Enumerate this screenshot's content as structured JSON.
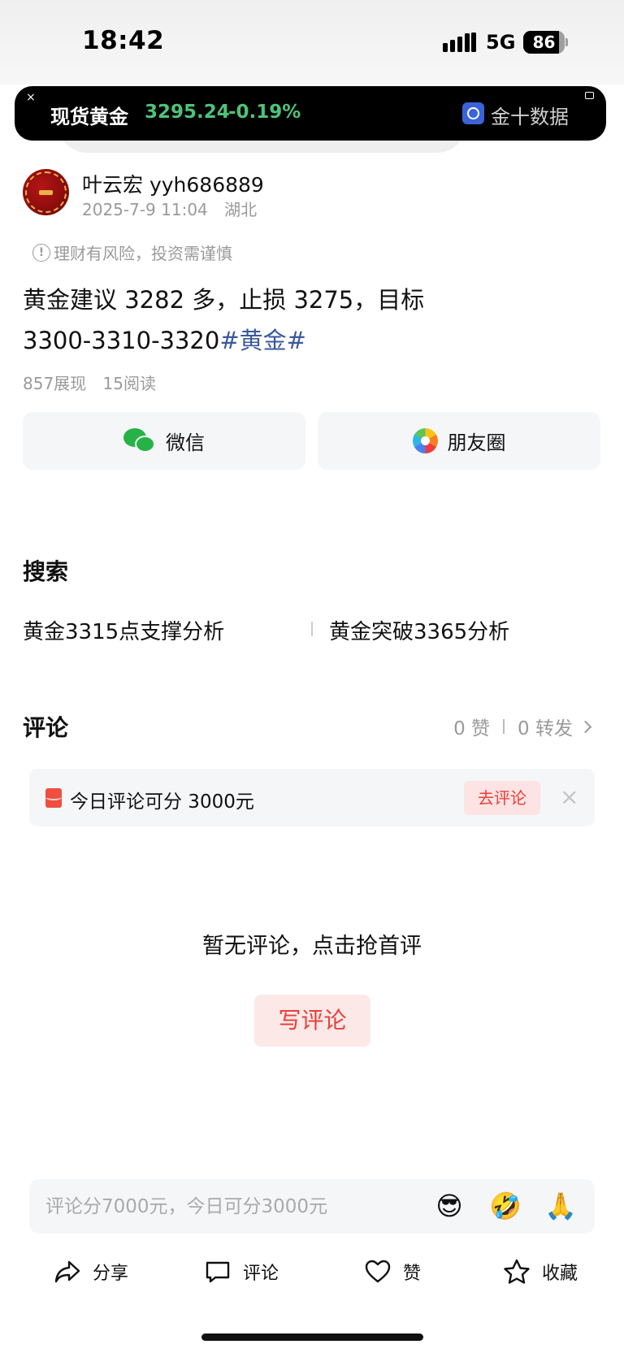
{
  "status_bar": {
    "time": "18:42",
    "network": "5G",
    "battery_level": 86,
    "battery_text": "86"
  },
  "ticker": {
    "close_glyph": "×",
    "name": "现货黄金",
    "price": "3295.24",
    "change": "-0.19%",
    "source": "金十数据",
    "price_color": "#4ec27a"
  },
  "post": {
    "author": "叶云宏 yyh686889",
    "date": "2025-7-9 11:04",
    "location": "湖北",
    "risk_notice": "理财有风险，投资需谨慎",
    "body_line1": "黄金建议 3282 多，止损 3275，目标",
    "body_line2": "3300-3310-3320",
    "hashtag": "#黄金#",
    "impressions": "857展现",
    "reads": "15阅读"
  },
  "share": {
    "wechat_label": "微信",
    "moments_label": "朋友圈"
  },
  "search": {
    "title": "搜索",
    "links": [
      "黄金3315点支撑分析",
      "黄金突破3365分析"
    ]
  },
  "comments": {
    "title": "评论",
    "likes": "0 赞",
    "forwards": "0 转发",
    "promo_text": "今日评论可分 3000元",
    "promo_button": "去评论",
    "promo_close": "×",
    "empty_text": "暂无评论，点击抢首评",
    "write_button": "写评论",
    "input_placeholder": "评论分7000元，今日可分3000元",
    "emojis": [
      "😎",
      "🤣",
      "🙏"
    ]
  },
  "bottom_bar": {
    "share": "分享",
    "comment": "评论",
    "like": "赞",
    "favorite": "收藏"
  },
  "colors": {
    "accent_red": "#e8403a",
    "hashtag_blue": "#3a5a9c",
    "wechat_green": "#26b246"
  }
}
